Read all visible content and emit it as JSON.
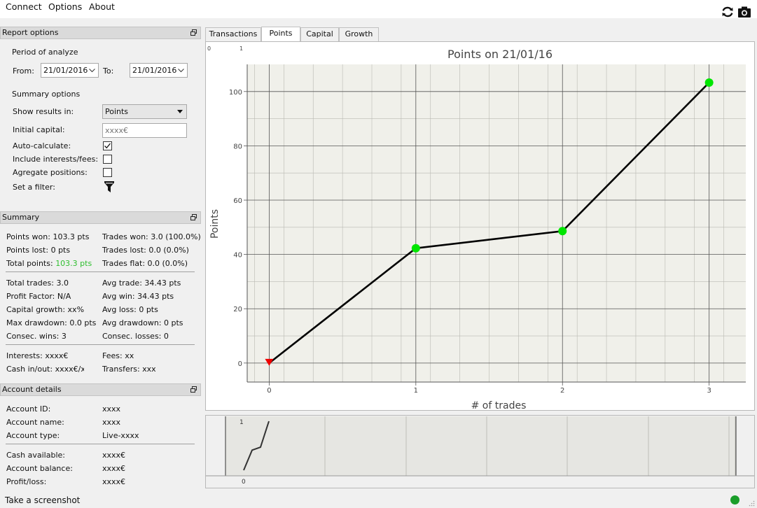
{
  "menu": {
    "connect": "Connect",
    "options": "Options",
    "about": "About"
  },
  "report_options": {
    "title": "Report options",
    "period_title": "Period of analyze",
    "from_label": "From:",
    "from_value": "21/01/2016",
    "to_label": "To:",
    "to_value": "21/01/2016",
    "summary_title": "Summary options",
    "show_results_label": "Show results in:",
    "show_results_value": "Points",
    "initial_capital_label": "Initial capital:",
    "initial_capital_placeholder": "xxxx€",
    "auto_calc_label": "Auto-calculate:",
    "auto_calc_checked": true,
    "interests_label": "Include interests/fees:",
    "aggregate_label": "Agregate positions:",
    "filter_label": "Set a filter:"
  },
  "summary": {
    "title": "Summary",
    "points_won": "Points won: 103.3 pts",
    "points_lost": "Points lost: 0 pts",
    "total_points_label": "Total points:",
    "total_points_value": "103.3 pts",
    "trades_won": "Trades won: 3.0 (100.0%)",
    "trades_lost": "Trades lost: 0.0 (0.0%)",
    "trades_flat": "Trades flat: 0.0 (0.0%)",
    "total_trades": "Total trades: 3.0",
    "profit_factor": "Profit Factor: N/A",
    "capital_growth": "Capital growth: xx%",
    "max_drawdown": "Max drawdown: 0.0 pts",
    "consec_wins": "Consec. wins: 3",
    "avg_trade": "Avg trade: 34.43 pts",
    "avg_win": "Avg win: 34.43 pts",
    "avg_loss": "Avg loss: 0 pts",
    "avg_drawdown": "Avg drawdown: 0 pts",
    "consec_losses": "Consec. losses: 0",
    "interests": "Interests: xxxx€",
    "cash_in_out": "Cash in/out: xxxx€/xx",
    "fees": "Fees: xx",
    "transfers": "Transfers: xxxx",
    "accent_color": "#2fbf2f"
  },
  "account": {
    "title": "Account details",
    "id_label": "Account ID:",
    "id_value": "xxxx",
    "name_label": "Account name:",
    "name_value": "xxxx",
    "type_label": "Account type:",
    "type_value": "Live-xxxx",
    "cash_label": "Cash available:",
    "cash_value": "xxxx€",
    "balance_label": "Account balance:",
    "balance_value": "xxxx€",
    "pl_label": "Profit/loss:",
    "pl_value": "xxxx€"
  },
  "tabs": [
    "Transactions",
    "Points",
    "Capital",
    "Growth"
  ],
  "active_tab": "Points",
  "chart_data": {
    "type": "line",
    "title": "Points on 21/01/16",
    "xlabel": "# of trades",
    "ylabel": "Points",
    "x": [
      0,
      1,
      2,
      3
    ],
    "series": [
      {
        "values": [
          0,
          42.3,
          48.6,
          103.3
        ]
      }
    ],
    "xlim": [
      -0.15,
      3.25
    ],
    "ylim": [
      -7,
      110
    ],
    "xticks": [
      "0",
      "1",
      "2",
      "3"
    ],
    "yticks": [
      "0",
      "20",
      "40",
      "60",
      "80",
      "100"
    ],
    "grid": true,
    "line_color": "#000000",
    "marker_color": "#00e600",
    "start_marker_color": "#ee0000",
    "corner_labels": [
      "0",
      "1"
    ]
  },
  "navigator": {
    "x_label": "0",
    "y_label": "1",
    "values": [
      0,
      42.3,
      48.6,
      103.3
    ]
  },
  "status": {
    "text": "Take a screenshot",
    "indicator_color": "#1a9e2a"
  }
}
